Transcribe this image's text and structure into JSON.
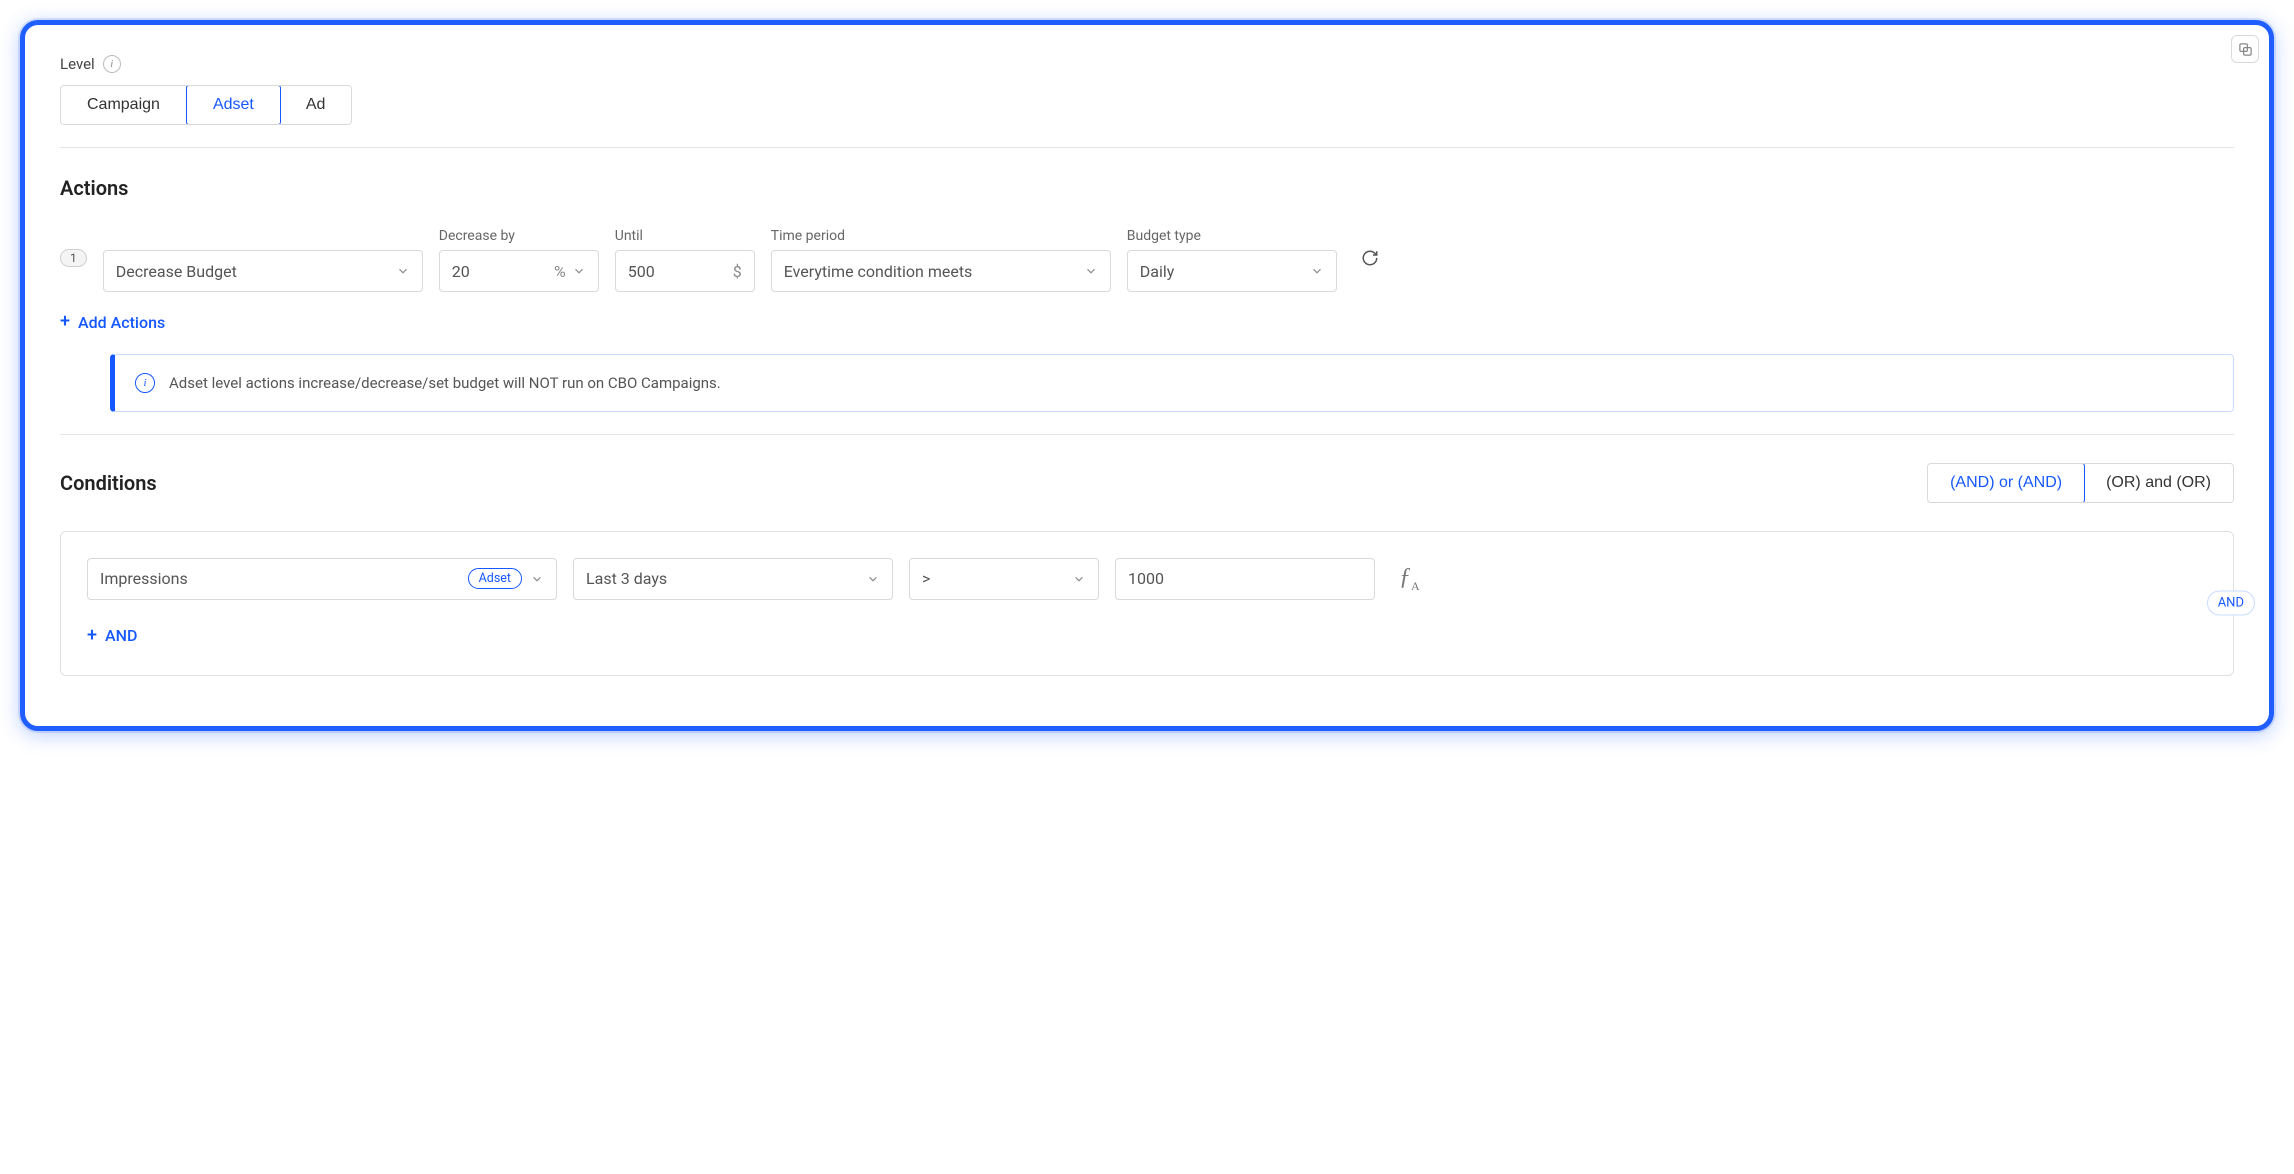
{
  "copy_icon": "copy",
  "level": {
    "label": "Level",
    "options": [
      "Campaign",
      "Adset",
      "Ad"
    ],
    "active": "Adset"
  },
  "actions": {
    "title": "Actions",
    "row": {
      "step": "1",
      "action_select": "Decrease Budget",
      "decrease_label": "Decrease by",
      "decrease_value": "20",
      "decrease_unit": "%",
      "until_label": "Until",
      "until_value": "500",
      "until_unit": "$",
      "period_label": "Time period",
      "period_value": "Everytime condition meets",
      "budget_label": "Budget type",
      "budget_value": "Daily"
    },
    "add_label": "Add Actions",
    "info": "Adset level actions increase/decrease/set budget will NOT run on CBO Campaigns."
  },
  "conditions": {
    "title": "Conditions",
    "logic": {
      "and_and": "(AND) or (AND)",
      "or_or": "(OR) and (OR)"
    },
    "row": {
      "metric": "Impressions",
      "scope": "Adset",
      "range": "Last 3 days",
      "op": ">",
      "value": "1000"
    },
    "add_label": "AND",
    "side_tag": "AND"
  }
}
